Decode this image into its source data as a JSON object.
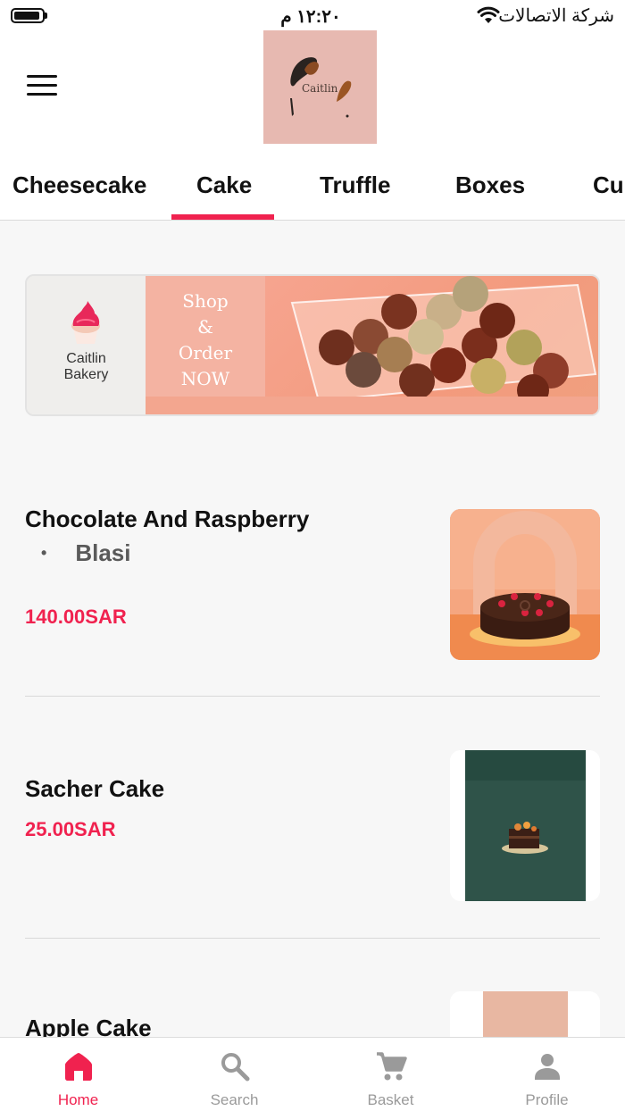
{
  "status_bar": {
    "time": "١٢:٢٠ م",
    "carrier": "شركة الاتصالات"
  },
  "header": {
    "logo_text": "Caitlin"
  },
  "tabs": [
    {
      "label": "Cheesecake"
    },
    {
      "label": "Cake",
      "active": true
    },
    {
      "label": "Truffle"
    },
    {
      "label": "Boxes"
    },
    {
      "label": "Cup"
    }
  ],
  "banner": {
    "brand_line1": "Caitlin",
    "brand_line2": "Bakery",
    "cta_line1": "Shop",
    "cta_line2": "&",
    "cta_line3": "Order",
    "cta_line4": "NOW"
  },
  "products": [
    {
      "name": "Chocolate And Raspberry",
      "desc": "Blasi",
      "price": "140.00SAR"
    },
    {
      "name": "Sacher Cake",
      "price": "25.00SAR"
    },
    {
      "name": "Apple Cake"
    }
  ],
  "bottom_nav": [
    {
      "label": "Home",
      "icon": "home-icon",
      "active": true
    },
    {
      "label": "Search",
      "icon": "search-icon"
    },
    {
      "label": "Basket",
      "icon": "cart-icon"
    },
    {
      "label": "Profile",
      "icon": "person-icon"
    }
  ],
  "colors": {
    "accent": "#f0224f",
    "inactive": "#9a9a9a",
    "logo_bg": "#e7b9b1"
  }
}
